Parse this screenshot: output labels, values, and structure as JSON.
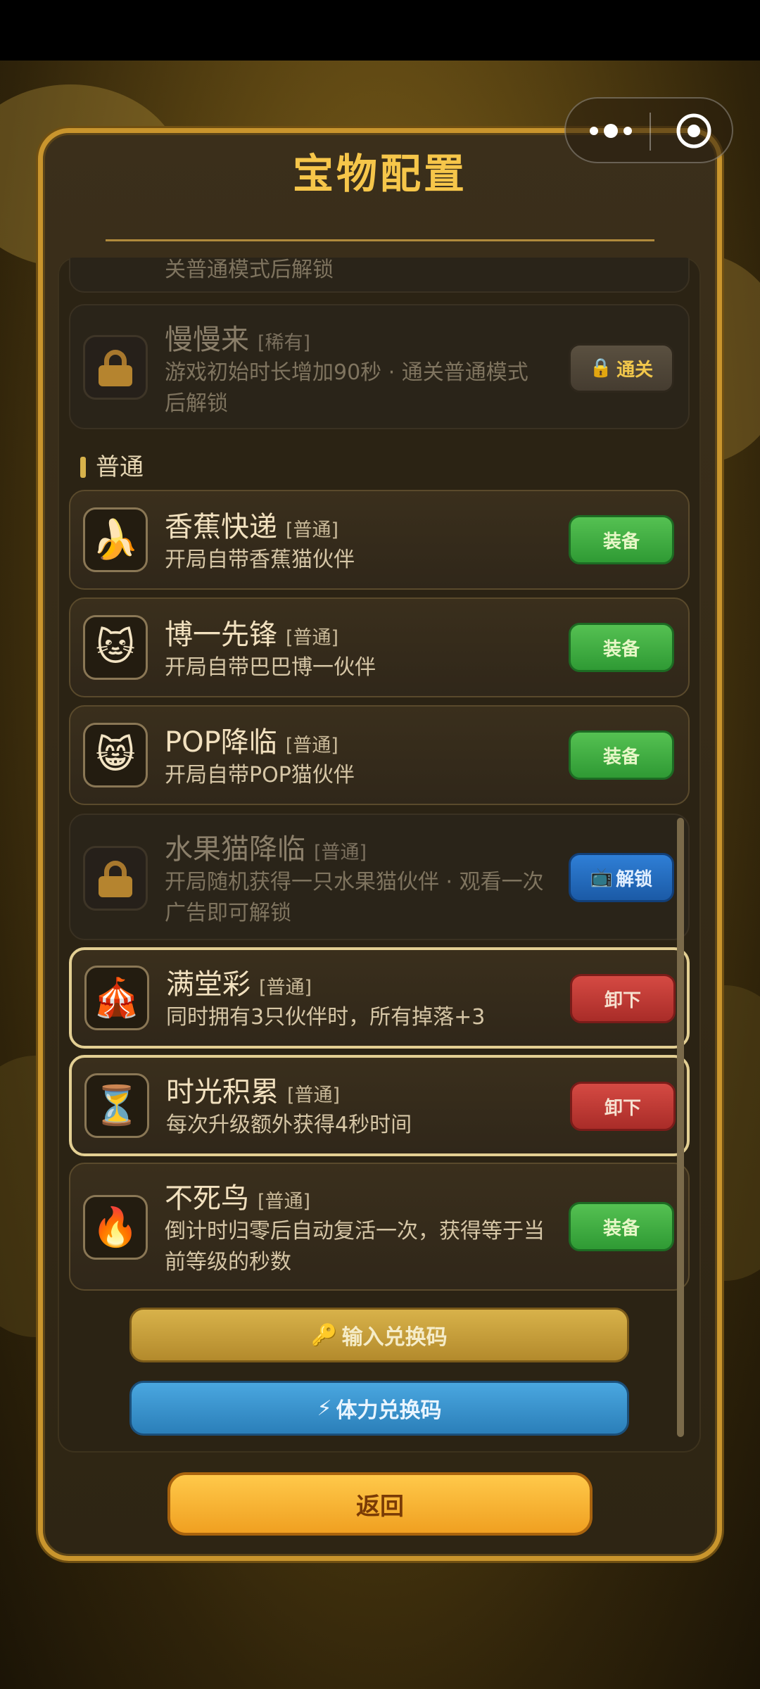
{
  "header": {
    "title": "宝物配置"
  },
  "top_card": {
    "desc": "关普通模式后解锁"
  },
  "rare_item": {
    "name": "慢慢来",
    "tag": "[稀有]",
    "desc": "游戏初始时长增加90秒 · 通关普通模式后解锁",
    "button": "通关",
    "locked": true
  },
  "section_label": "普通",
  "items": [
    {
      "name": "香蕉快递",
      "tag": "[普通]",
      "desc": "开局自带香蕉猫伙伴",
      "icon": "🍌",
      "icon_name": "banana-icon",
      "button": "装备",
      "state": "equip"
    },
    {
      "name": "博一先锋",
      "tag": "[普通]",
      "desc": "开局自带巴巴博一伙伴",
      "icon": "🐱",
      "icon_name": "cat-face-icon",
      "button": "装备",
      "state": "equip"
    },
    {
      "name": "POP降临",
      "tag": "[普通]",
      "desc": "开局自带POP猫伙伴",
      "icon": "😸",
      "icon_name": "grinning-cat-icon",
      "button": "装备",
      "state": "equip"
    },
    {
      "name": "水果猫降临",
      "tag": "[普通]",
      "desc": "开局随机获得一只水果猫伙伴 · 观看一次广告即可解锁",
      "icon": "lock",
      "icon_name": "lock-icon",
      "button": "解锁",
      "state": "unlock"
    },
    {
      "name": "满堂彩",
      "tag": "[普通]",
      "desc": "同时拥有3只伙伴时，所有掉落+3",
      "icon": "🎪",
      "icon_name": "circus-tent-icon",
      "button": "卸下",
      "state": "unequip"
    },
    {
      "name": "时光积累",
      "tag": "[普通]",
      "desc": "每次升级额外获得4秒时间",
      "icon": "⏳",
      "icon_name": "hourglass-icon",
      "button": "卸下",
      "state": "unequip"
    },
    {
      "name": "不死鸟",
      "tag": "[普通]",
      "desc": "倒计时归零后自动复活一次，获得等于当前等级的秒数",
      "icon": "🔥",
      "icon_name": "fire-icon",
      "button": "装备",
      "state": "equip"
    }
  ],
  "buttons": {
    "redeem": "输入兑换码",
    "stamina": "体力兑换码",
    "back": "返回"
  },
  "colors": {
    "gold": "#f6c64a",
    "equip": "#3fae40",
    "unequip": "#c63b35",
    "unlock": "#2a71c6",
    "back": "#f6b22c"
  }
}
